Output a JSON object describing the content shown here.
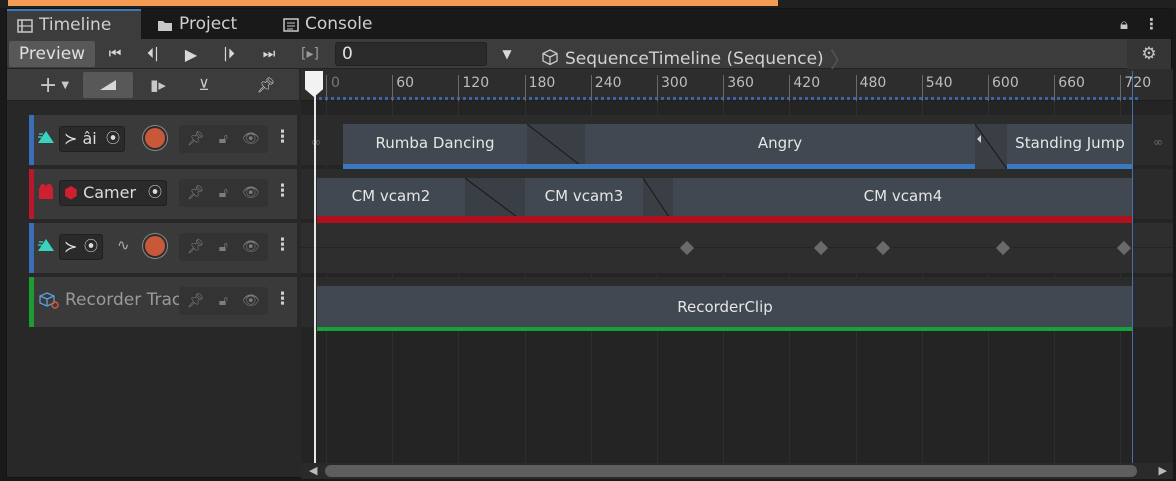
{
  "tabs": [
    {
      "label": "Timeline",
      "icon": "timeline-icon"
    },
    {
      "label": "Project",
      "icon": "folder-icon"
    },
    {
      "label": "Console",
      "icon": "console-icon"
    }
  ],
  "controls": {
    "preview_label": "Preview",
    "frame_value": "0",
    "sequence_label": "SequenceTimeline (Sequence)"
  },
  "ruler": {
    "ticks": [
      "60",
      "120",
      "180",
      "240",
      "300",
      "360",
      "420",
      "480",
      "540",
      "600",
      "660",
      "720"
    ]
  },
  "tracks": [
    {
      "type": "animation",
      "binding": "âi",
      "color": "#3a6fb8",
      "clips": [
        "Rumba Dancing",
        "Angry",
        "Standing Jump"
      ],
      "underline": "#3a79c0"
    },
    {
      "type": "cinemachine",
      "binding": "Camer",
      "color": "#b8182b",
      "clips": [
        "CM vcam2",
        "CM vcam3",
        "CM vcam4"
      ],
      "underline": "#b0101d"
    },
    {
      "type": "animation-recorded",
      "binding": "",
      "color": "#3a6fb8"
    },
    {
      "type": "recorder",
      "label": "Recorder Track",
      "color": "#1e9b33",
      "clips": [
        "RecorderClip"
      ],
      "underline": "#15a23a"
    }
  ]
}
